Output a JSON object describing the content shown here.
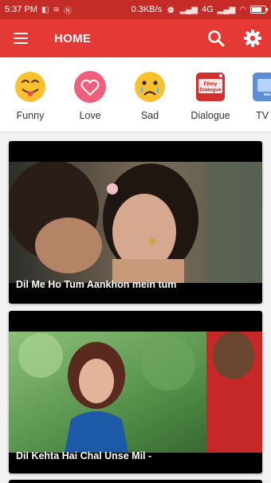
{
  "status_bar": {
    "time": "5:37 PM",
    "speed": "0.3KB/s",
    "network": "4G",
    "battery_level": 0.75
  },
  "header": {
    "title": "HOME",
    "menu_icon": "hamburger-menu-icon",
    "search_icon": "search-icon",
    "settings_icon": "gear-icon"
  },
  "categories": [
    {
      "label": "Funny",
      "icon": "tongue-out-emoji-icon"
    },
    {
      "label": "Love",
      "icon": "heart-icon"
    },
    {
      "label": "Sad",
      "icon": "crying-emoji-icon"
    },
    {
      "label": "Dialogue",
      "icon": "filmy-dialogue-icon",
      "icon_text": "Filmy Dialogue"
    },
    {
      "label": "TV S",
      "icon": "tv-icon"
    }
  ],
  "videos": [
    {
      "caption": "Dil Me Ho Tum Aankhon mein tum"
    },
    {
      "caption": "Dil Kehta Hai Chal Unse Mil -"
    }
  ],
  "colors": {
    "status_bar": "#c62c27",
    "app_bar": "#e53935",
    "card_bg": "#000000"
  }
}
